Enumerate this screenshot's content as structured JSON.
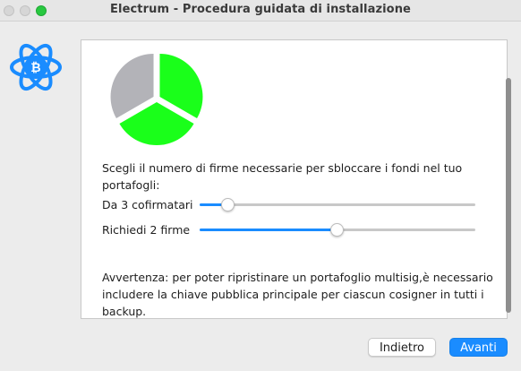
{
  "window": {
    "title": "Electrum  -  Procedura guidata di installazione"
  },
  "colors": {
    "accent": "#1a8cff",
    "pie_required": "#1aff1a",
    "pie_remaining": "#b3b3b8"
  },
  "wizard": {
    "instruction": "Scegli il numero di firme necessarie per sbloccare i fondi nel tuo portafogli:",
    "cosigners": {
      "label": "Da 3 cofirmatari",
      "value": 3,
      "min": 2,
      "max": 15
    },
    "signatures": {
      "label": "Richiedi 2 firme",
      "value": 2,
      "min": 1,
      "max": 3
    },
    "pie": {
      "required": 2,
      "total": 3
    },
    "warning": "Avvertenza: per poter ripristinare un portafoglio multisig,è necessario includere la chiave pubblica principale per ciascun cosigner in tutti i backup."
  },
  "buttons": {
    "back": "Indietro",
    "next": "Avanti"
  },
  "icons": {
    "logo": "electrum-logo-icon"
  }
}
